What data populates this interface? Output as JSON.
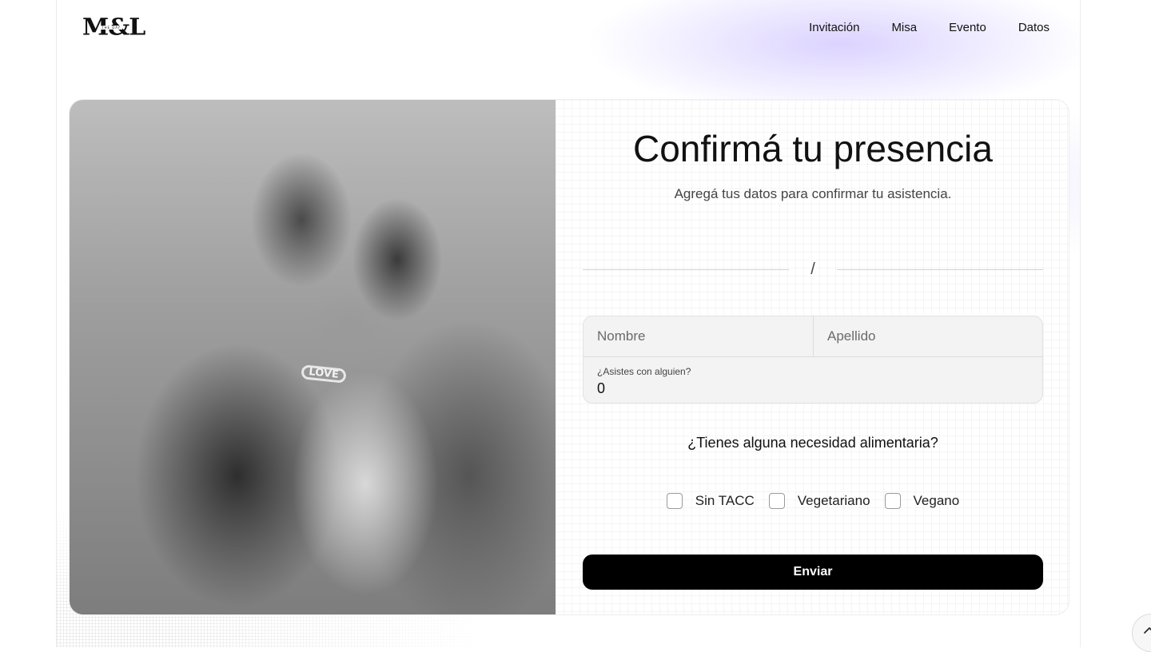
{
  "brand": {
    "logo_text": "M&L",
    "logo_subtext": "THE DAY"
  },
  "nav": {
    "items": [
      {
        "label": "Invitación"
      },
      {
        "label": "Misa"
      },
      {
        "label": "Evento"
      },
      {
        "label": "Datos"
      }
    ]
  },
  "photo": {
    "ring_text": "LOVE"
  },
  "form": {
    "title": "Confirmá tu presencia",
    "subtitle": "Agregá tus datos para confirmar tu asistencia.",
    "divider_text": "/",
    "name_placeholder": "Nombre",
    "surname_placeholder": "Apellido",
    "guests_label": "¿Asistes con alguien?",
    "guests_value": "0",
    "diet_question": "¿Tienes alguna necesidad alimentaria?",
    "diet_options": [
      {
        "label": "Sin TACC",
        "checked": false
      },
      {
        "label": "Vegetariano",
        "checked": false
      },
      {
        "label": "Vegano",
        "checked": false
      }
    ],
    "submit_label": "Enviar"
  },
  "icons": {
    "scroll_top": "chevron-up-icon"
  },
  "colors": {
    "accent_glow": "#BEAFFF",
    "button_bg": "#000000",
    "field_bg": "#F3F3F3"
  }
}
